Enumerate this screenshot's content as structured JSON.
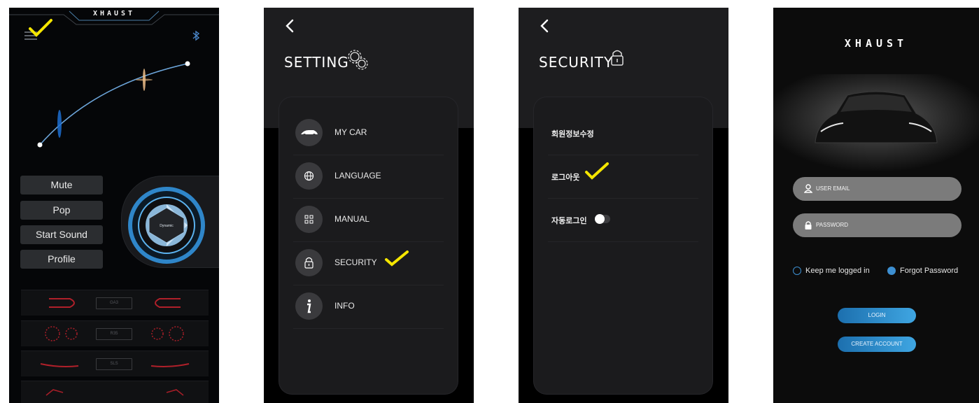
{
  "colors": {
    "check": "#f5e600",
    "accent_blue": "#2f86c9",
    "panel": "#1b1b1d"
  },
  "screen1": {
    "logo": "XHAUST",
    "icons": [
      "menu-icon",
      "bluetooth-icon"
    ],
    "buttons": [
      "Mute",
      "Pop",
      "Start Sound",
      "Profile"
    ],
    "knob_label": "Dynamic",
    "profiles": [
      "GA3",
      "R35",
      "SLS"
    ]
  },
  "screen2": {
    "title": "SETTING",
    "items": [
      {
        "label": "MY CAR",
        "icon": "car-icon"
      },
      {
        "label": "LANGUAGE",
        "icon": "globe-icon"
      },
      {
        "label": "MANUAL",
        "icon": "grid-icon"
      },
      {
        "label": "SECURITY",
        "icon": "lock-icon"
      },
      {
        "label": "INFO",
        "icon": "info-icon"
      }
    ]
  },
  "screen3": {
    "title": "SECURITY",
    "items": [
      "회원정보수정",
      "로그아웃",
      "자동로그인"
    ],
    "auto_login_enabled": false
  },
  "screen4": {
    "logo": "XHAUST",
    "email_placeholder": "USER EMAIL",
    "password_placeholder": "PASSWORD",
    "keep_logged_in": "Keep me logged in",
    "forgot_password": "Forgot Password",
    "login_label": "LOGIN",
    "create_account_label": "CREATE ACCOUNT"
  }
}
